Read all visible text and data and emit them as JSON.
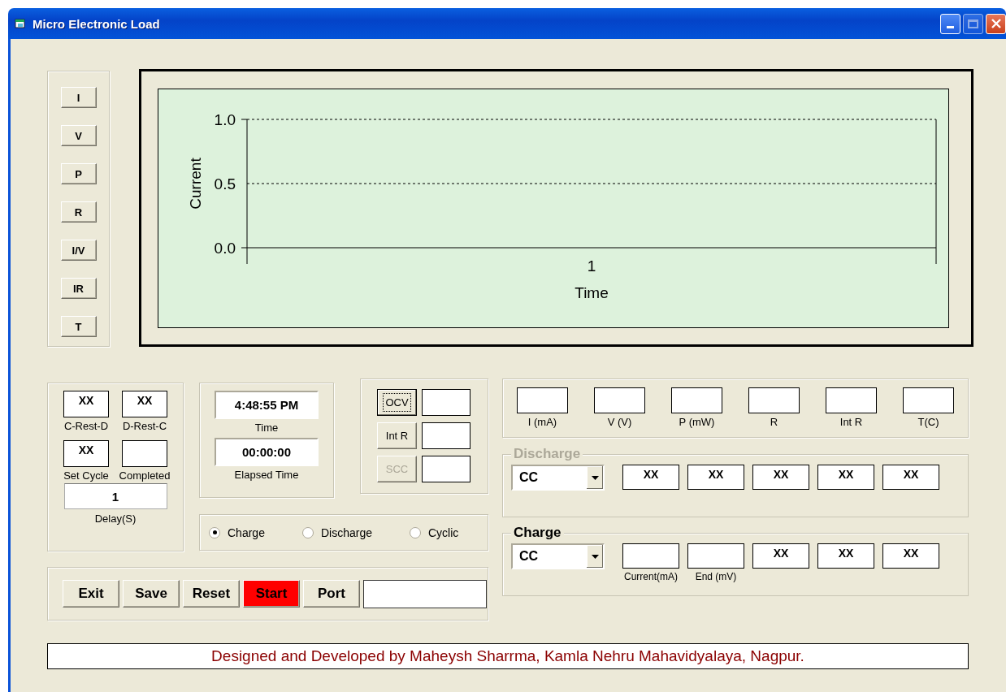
{
  "window": {
    "title": "Micro Electronic Load"
  },
  "plot_buttons": [
    "I",
    "V",
    "P",
    "R",
    "I/V",
    "IR",
    "T"
  ],
  "chart": {
    "chart_data": {
      "type": "line",
      "xlabel": "Time",
      "ylabel": "Current",
      "ylim": [
        0,
        1
      ],
      "yticks": [
        {
          "value": 0,
          "label": "0.0"
        },
        {
          "value": 0.5,
          "label": "0.5"
        },
        {
          "value": 1,
          "label": "1.0"
        }
      ],
      "categories": [
        "1"
      ]
    }
  },
  "cycle_fields": [
    {
      "label": "C-Rest-D",
      "value": "XX"
    },
    {
      "label": "D-Rest-C",
      "value": "XX"
    },
    {
      "label": "Set Cycle",
      "value": "XX"
    },
    {
      "label": "Completed"
    }
  ],
  "delay": {
    "label": "Delay(S)",
    "value": "1"
  },
  "clock": [
    {
      "label": "Time",
      "value": "4:48:55 PM"
    },
    {
      "label": "Elapsed Time",
      "value": "00:00:00"
    }
  ],
  "tests": [
    {
      "label": "OCV",
      "focused": true,
      "disabled": false
    },
    {
      "label": "Int R",
      "focused": false,
      "disabled": false
    },
    {
      "label": "SCC",
      "focused": false,
      "disabled": true
    }
  ],
  "mode": [
    {
      "label": "Charge",
      "selected": true
    },
    {
      "label": "Discharge",
      "selected": false
    },
    {
      "label": "Cyclic",
      "selected": false
    }
  ],
  "actions": [
    {
      "label": "Exit",
      "kind": "normal"
    },
    {
      "label": "Save",
      "kind": "normal"
    },
    {
      "label": "Reset",
      "kind": "normal"
    },
    {
      "label": "Start",
      "kind": "alert"
    },
    {
      "label": "Port",
      "kind": "normal"
    }
  ],
  "readings": [
    "I (mA)",
    "V (V)",
    "P (mW)",
    "R",
    "Int R",
    "T(C)"
  ],
  "discharge": {
    "title": "Discharge",
    "disabled": true,
    "mode": "CC",
    "fields": [
      {
        "value": "XX"
      },
      {
        "value": "XX"
      },
      {
        "value": "XX"
      },
      {
        "value": "XX"
      },
      {
        "value": "XX"
      }
    ]
  },
  "charge": {
    "title": "Charge",
    "disabled": false,
    "mode": "CC",
    "fields": [
      {
        "label": "Current(mA)"
      },
      {
        "label": "End (mV)"
      },
      {
        "value": "XX"
      },
      {
        "value": "XX"
      },
      {
        "value": "XX"
      }
    ]
  },
  "footer": "Designed and Developed by Maheysh Sharrma, Kamla Nehru Mahavidyalaya, Nagpur."
}
